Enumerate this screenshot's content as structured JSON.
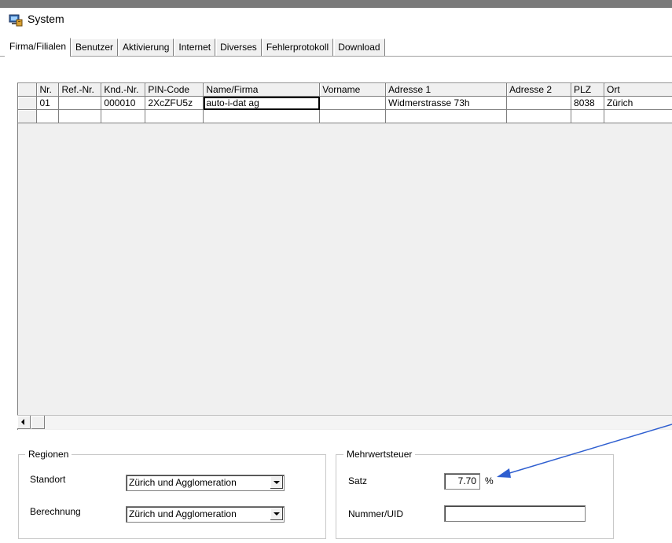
{
  "window": {
    "title": "System",
    "icon": "system-computer-icon"
  },
  "tabs": [
    {
      "label": "Firma/Filialen",
      "active": true
    },
    {
      "label": "Benutzer"
    },
    {
      "label": "Aktivierung"
    },
    {
      "label": "Internet"
    },
    {
      "label": "Diverses"
    },
    {
      "label": "Fehlerprotokoll"
    },
    {
      "label": "Download"
    }
  ],
  "grid": {
    "columns": [
      "Nr.",
      "Ref.-Nr.",
      "Knd.-Nr.",
      "PIN-Code",
      "Name/Firma",
      "Vorname",
      "Adresse 1",
      "Adresse 2",
      "PLZ",
      "Ort"
    ],
    "rows": [
      [
        "01",
        "",
        "000010",
        "2XcZFU5z",
        "auto-i-dat ag",
        "",
        "Widmerstrasse 73h",
        "",
        "8038",
        "Zürich"
      ]
    ]
  },
  "regionen": {
    "title": "Regionen",
    "standort_label": "Standort",
    "standort_value": "Zürich und Agglomeration",
    "berechnung_label": "Berechnung",
    "berechnung_value": "Zürich und Agglomeration"
  },
  "mwst": {
    "title": "Mehrwertsteuer",
    "satz_label": "Satz",
    "satz_value": "7.70",
    "satz_unit": "%",
    "nummer_label": "Nummer/UID",
    "nummer_value": ""
  },
  "annotation": {
    "color": "#2f5fd0"
  }
}
